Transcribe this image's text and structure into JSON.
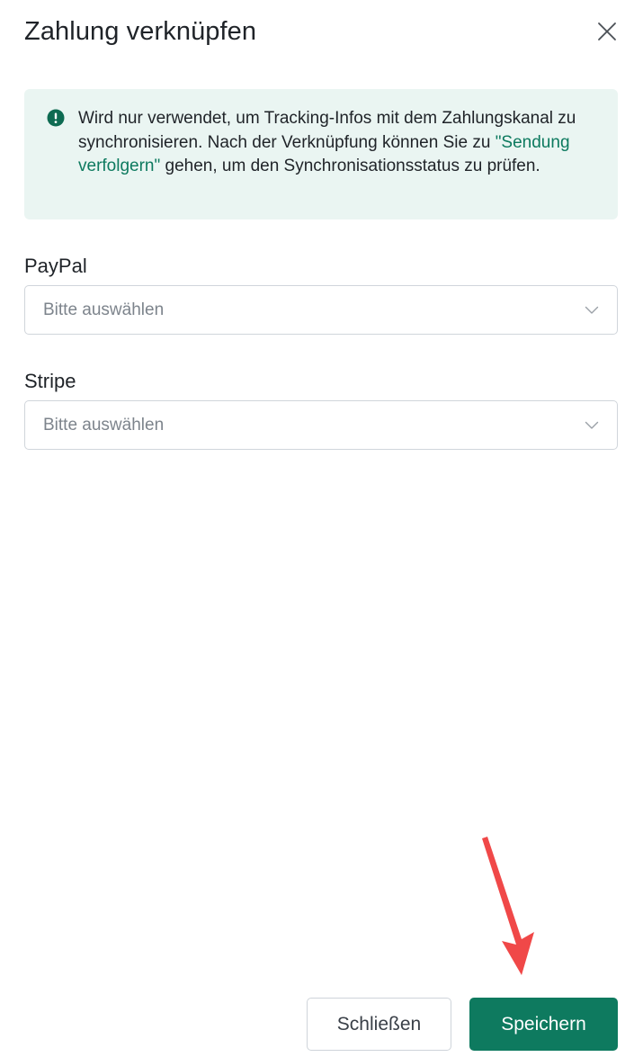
{
  "dialog": {
    "title": "Zahlung verknüpfen"
  },
  "notice": {
    "text_before": "Wird nur verwendet, um Tracking-Infos mit dem Zahlungskanal zu synchronisieren. Nach der Verknüpfung können Sie zu ",
    "link_text": "\"Sendung verfolgern\"",
    "text_after": " gehen, um den Synchronisationsstatus zu prüfen."
  },
  "fields": [
    {
      "label": "PayPal",
      "placeholder": "Bitte auswählen"
    },
    {
      "label": "Stripe",
      "placeholder": "Bitte auswählen"
    }
  ],
  "footer": {
    "close_label": "Schließen",
    "save_label": "Speichern"
  },
  "colors": {
    "accent": "#0e7a5f",
    "notice_bg": "#eaf5f2",
    "annotation_arrow": "#f04848"
  },
  "icons": {
    "close": "close-icon",
    "notice": "exclamation-circle-icon",
    "dropdown": "chevron-down-icon",
    "annotation": "red-arrow-annotation"
  }
}
